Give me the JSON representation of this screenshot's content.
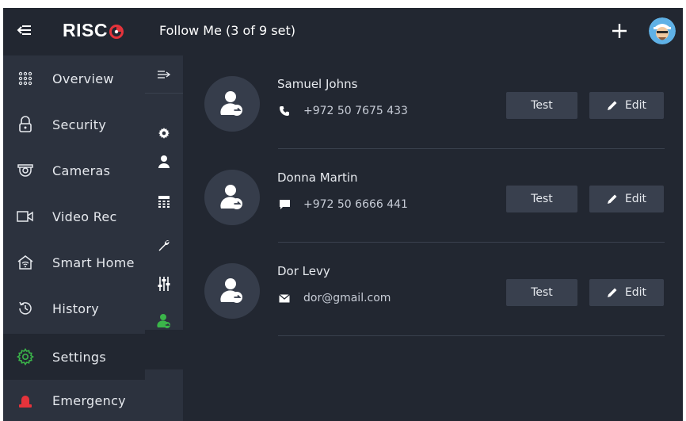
{
  "brand": {
    "logo_text": "RISC",
    "logo_color": "#e5333b"
  },
  "header": {
    "title": "Follow Me (3 of 9 set)"
  },
  "sidebar": {
    "items": [
      {
        "label": "Overview",
        "icon": "grid-dots-icon"
      },
      {
        "label": "Security",
        "icon": "lock-icon"
      },
      {
        "label": "Cameras",
        "icon": "camera-icon"
      },
      {
        "label": "Video Rec",
        "icon": "video-icon"
      },
      {
        "label": "Smart Home",
        "icon": "smart-home-icon"
      },
      {
        "label": "History",
        "icon": "history-icon"
      },
      {
        "label": "Settings",
        "icon": "gear-icon",
        "active": true
      },
      {
        "label": "Emergency",
        "icon": "siren-icon"
      }
    ]
  },
  "subnav": {
    "items": [
      "expand-icon",
      "gear-icon",
      "user-icon",
      "keypad-icon",
      "wrench-icon",
      "sliders-icon",
      "follow-me-icon"
    ],
    "active_color": "#3bb54a"
  },
  "contacts": [
    {
      "name": "Samuel Johns",
      "detail": "+972 50 7675 433",
      "detail_icon": "phone-icon",
      "test_label": "Test",
      "edit_label": "Edit"
    },
    {
      "name": "Donna Martin",
      "detail": "+972 50 6666 441",
      "detail_icon": "sms-icon",
      "test_label": "Test",
      "edit_label": "Edit"
    },
    {
      "name": "Dor Levy",
      "detail": "dor@gmail.com",
      "detail_icon": "email-icon",
      "test_label": "Test",
      "edit_label": "Edit"
    }
  ],
  "colors": {
    "accent_green": "#3bb54a",
    "panel": "#2c323e",
    "background": "#222731"
  }
}
